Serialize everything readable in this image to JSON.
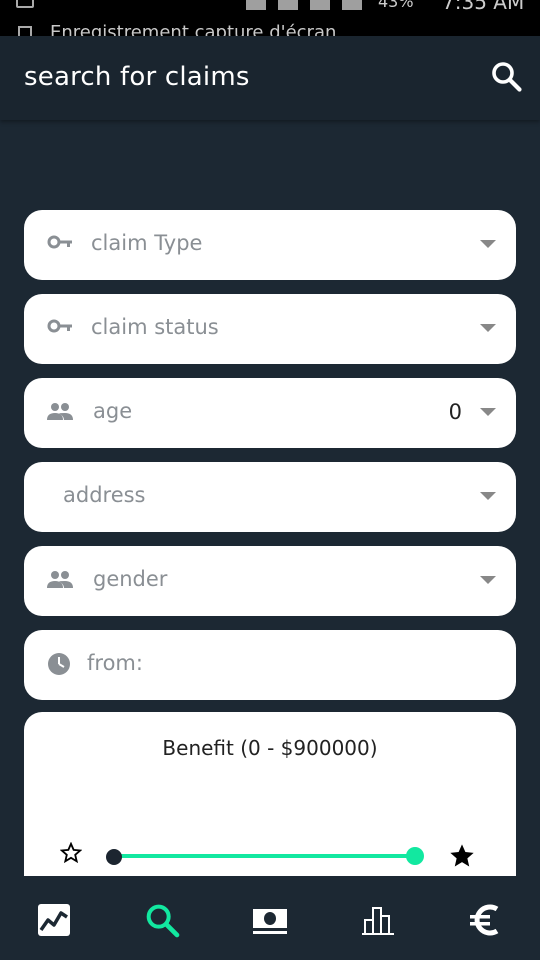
{
  "status_bar": {
    "battery_text": "43%",
    "time": "7:35 AM",
    "notification_text": "Enregistrement capture d'écran"
  },
  "app_bar": {
    "title": "search for claims",
    "search_icon": "search-icon"
  },
  "form": {
    "claim_type": {
      "placeholder": "claim Type",
      "icon": "key-icon"
    },
    "claim_status": {
      "placeholder": "claim status",
      "icon": "key-icon"
    },
    "age": {
      "placeholder": "age",
      "value": "0",
      "icon": "people-icon"
    },
    "address": {
      "placeholder": "address"
    },
    "gender": {
      "placeholder": "gender",
      "icon": "people-icon"
    },
    "from": {
      "placeholder": "from:",
      "icon": "clock-icon"
    }
  },
  "benefit": {
    "title": "Benefit (0 - $900000)",
    "range_min": 0,
    "range_max": 900000
  },
  "bottom_nav": [
    {
      "icon": "chart-line-icon",
      "active": false
    },
    {
      "icon": "search-icon",
      "active": true
    },
    {
      "icon": "money-icon",
      "active": false
    },
    {
      "icon": "bar-chart-icon",
      "active": false
    },
    {
      "icon": "euro-icon",
      "active": false
    }
  ],
  "colors": {
    "background": "#1c2833",
    "accent": "#12e8a0",
    "field_bg": "#ffffff"
  }
}
